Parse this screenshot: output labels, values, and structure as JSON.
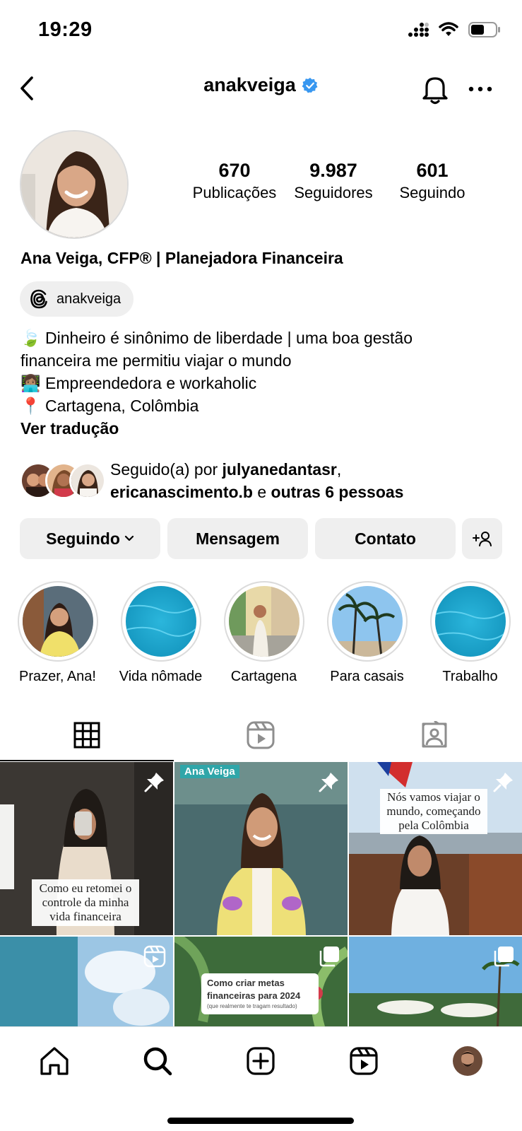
{
  "status_bar": {
    "time": "19:29"
  },
  "header": {
    "username": "anakveiga"
  },
  "stats": [
    {
      "value": "670",
      "label": "Publicações"
    },
    {
      "value": "9.987",
      "label": "Seguidores"
    },
    {
      "value": "601",
      "label": "Seguindo"
    }
  ],
  "profile": {
    "full_name": "Ana Veiga, CFP® | Planejadora Financeira",
    "threads_handle": "anakveiga",
    "bio_lines": [
      "🍃 Dinheiro é sinônimo de liberdade | uma boa gestão",
      "financeira me permitiu viajar o mundo",
      "👩🏽‍💻 Empreendedora e workaholic",
      "📍 Cartagena, Colômbia"
    ],
    "translate_label": "Ver tradução"
  },
  "followed_by": {
    "prefix": "Seguido(a) por ",
    "user1": "julyanedantasr",
    "sep1": ",",
    "user2": "ericanascimento.b",
    "conj": " e ",
    "others": "outras 6 pessoas"
  },
  "actions": {
    "following_label": "Seguindo",
    "message_label": "Mensagem",
    "contact_label": "Contato"
  },
  "highlights": [
    {
      "label": "Prazer, Ana!"
    },
    {
      "label": "Vida nômade"
    },
    {
      "label": "Cartagena"
    },
    {
      "label": "Para casais"
    },
    {
      "label": "Trabalho"
    }
  ],
  "posts": {
    "p1_caption": [
      "Como eu retomei o",
      "controle da minha",
      "vida financeira"
    ],
    "p2_brand": "Ana Veiga",
    "p3_caption": [
      "Nós vamos viajar o",
      "mundo, começando",
      "pela Colômbia"
    ],
    "p5_title": [
      "Como criar metas",
      "financeiras para 2024"
    ],
    "p5_sub": "(que realmente te tragam resultado)"
  },
  "icons": {
    "back": "chevron-left-icon",
    "verified": "verified-badge-icon",
    "bell": "bell-icon",
    "more": "more-horizontal-icon",
    "threads": "threads-icon",
    "add_person": "add-person-icon",
    "grid": "grid-icon",
    "reels": "reels-icon",
    "tagged": "tagged-icon",
    "pin": "pin-icon",
    "home": "home-icon",
    "search": "search-icon",
    "create": "create-icon"
  },
  "colors": {
    "verified_blue": "#3897f0",
    "button_bg": "#efefef"
  }
}
